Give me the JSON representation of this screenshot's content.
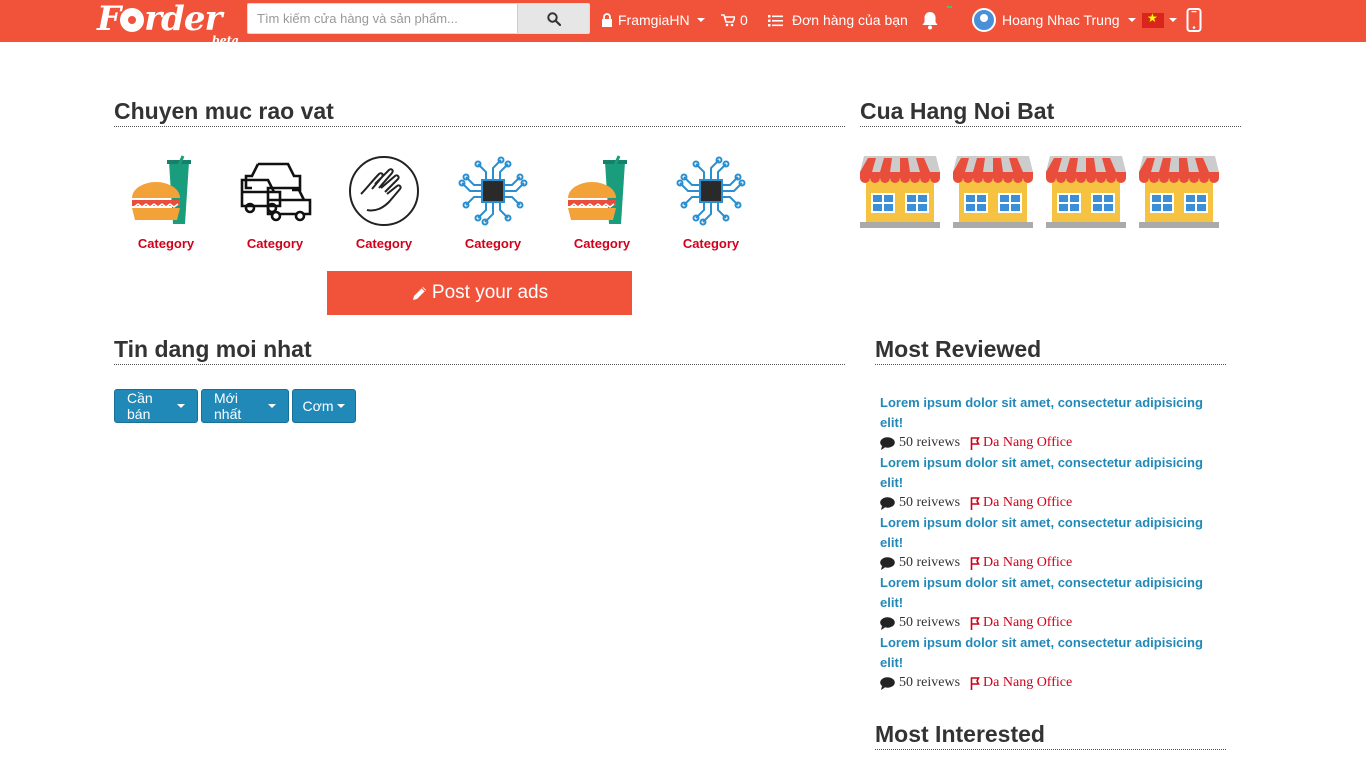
{
  "brand": {
    "name": "Forder",
    "tag": "beta"
  },
  "search": {
    "placeholder": "Tìm kiếm cửa hàng và sản phẩm..."
  },
  "nav": {
    "shop": "FramgiaHN",
    "cart_count": "0",
    "orders": "Đơn hàng của bạn",
    "user": "Hoang Nhac Trung"
  },
  "colors": {
    "brand": "#f0523a",
    "primary": "#2189b8",
    "category_text": "#d0021b"
  },
  "categories_section": {
    "title": "Chuyen muc rao vat",
    "items": [
      {
        "label": "Category",
        "icon": "food-icon"
      },
      {
        "label": "Category",
        "icon": "cars-icon"
      },
      {
        "label": "Category",
        "icon": "hand-icon"
      },
      {
        "label": "Category",
        "icon": "chip-icon"
      },
      {
        "label": "Category",
        "icon": "food-icon"
      },
      {
        "label": "Category",
        "icon": "chip-icon"
      }
    ],
    "post_button": "Post your ads"
  },
  "stores_section": {
    "title": "Cua Hang Noi Bat"
  },
  "latest_section": {
    "title": "Tin dang moi nhat",
    "filters": [
      "Cần bán",
      "Mới nhất",
      "Cơm"
    ]
  },
  "reviewed_section": {
    "title": "Most Reviewed",
    "items": [
      {
        "title": "Lorem ipsum dolor sit amet, consectetur adipisicing elit!",
        "reviews": "50 reivews",
        "location": "Da Nang Office"
      },
      {
        "title": "Lorem ipsum dolor sit amet, consectetur adipisicing elit!",
        "reviews": "50 reivews",
        "location": "Da Nang Office"
      },
      {
        "title": "Lorem ipsum dolor sit amet, consectetur adipisicing elit!",
        "reviews": "50 reivews",
        "location": "Da Nang Office"
      },
      {
        "title": "Lorem ipsum dolor sit amet, consectetur adipisicing elit!",
        "reviews": "50 reivews",
        "location": "Da Nang Office"
      },
      {
        "title": "Lorem ipsum dolor sit amet, consectetur adipisicing elit!",
        "reviews": "50 reivews",
        "location": "Da Nang Office"
      }
    ]
  },
  "interested_section": {
    "title": "Most Interested"
  }
}
